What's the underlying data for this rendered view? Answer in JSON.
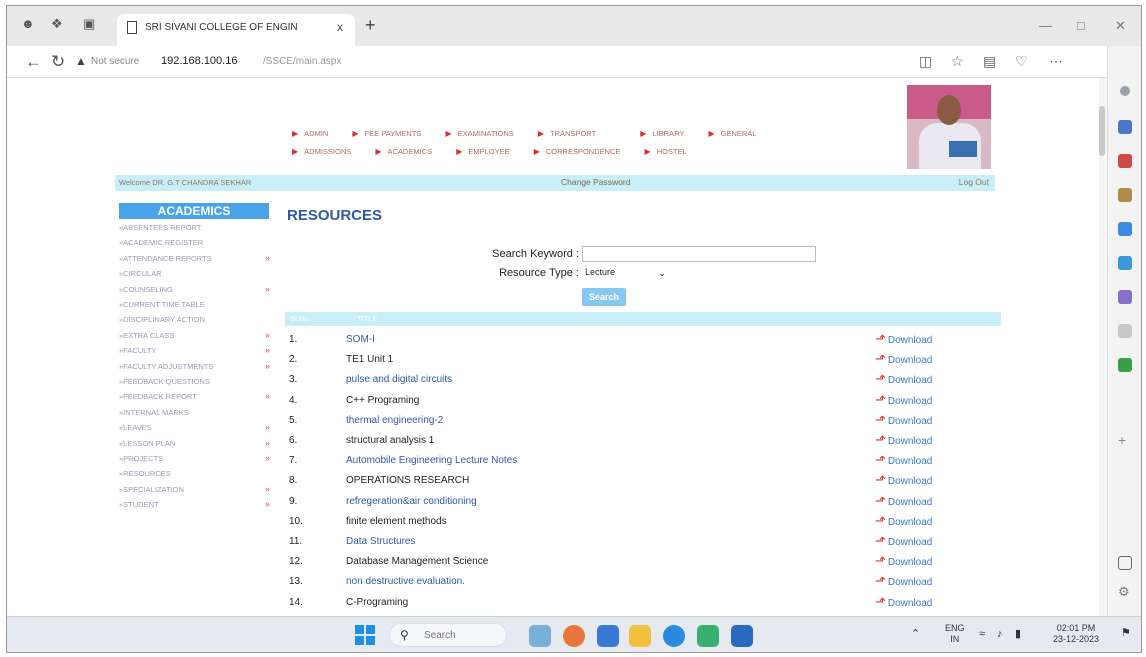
{
  "browser": {
    "tab_title": "SRI SIVANI COLLEGE OF ENGIN",
    "new_tab": "+",
    "close_tab": "x",
    "not_secure": "Not secure",
    "url_host": "192.168.100.16",
    "url_path": "/SSCE/main.aspx"
  },
  "top_nav": {
    "row1": [
      "ADMIN",
      "FEE PAYMENTS",
      "EXAMINATIONS",
      "TRANSPORT",
      "LIBRARY",
      "GENERAL"
    ],
    "row2": [
      "ADMISSIONS",
      "ACADEMICS",
      "EMPLOYEE",
      "CORRESPONDENCE",
      "HOSTEL"
    ]
  },
  "welcome": {
    "text": "Welcome DR. G.T CHANDRA SEKHAR",
    "change_password": "Change Password",
    "logout": "Log Out"
  },
  "sidebar": {
    "header": "ACADEMICS",
    "items": [
      {
        "label": "ABSENTEES REPORT",
        "arrow": false
      },
      {
        "label": "ACADEMIC REGISTER",
        "arrow": false
      },
      {
        "label": "ATTENDANCE REPORTS",
        "arrow": true
      },
      {
        "label": "CIRCULAR",
        "arrow": false
      },
      {
        "label": "COUNSELING",
        "arrow": true
      },
      {
        "label": "CURRENT TIME TABLE",
        "arrow": false
      },
      {
        "label": "DISCIPLINARY ACTION",
        "arrow": false
      },
      {
        "label": "EXTRA CLASS",
        "arrow": true
      },
      {
        "label": "FACULTY",
        "arrow": true
      },
      {
        "label": "FACULTY ADJUSTMENTS",
        "arrow": true
      },
      {
        "label": "FEEDBACK QUESTIONS",
        "arrow": false
      },
      {
        "label": "FEEDBACK REPORT",
        "arrow": true
      },
      {
        "label": "INTERNAL MARKS",
        "arrow": false
      },
      {
        "label": "LEAVES",
        "arrow": true
      },
      {
        "label": "LESSON PLAN",
        "arrow": true
      },
      {
        "label": "PROJECTS",
        "arrow": true
      },
      {
        "label": "RESOURCES",
        "arrow": false
      },
      {
        "label": "SPECIALIZATION",
        "arrow": true
      },
      {
        "label": "STUDENT",
        "arrow": true
      }
    ]
  },
  "main": {
    "title": "RESOURCES",
    "search_label": "Search Keyword :",
    "search_value": "",
    "type_label": "Resource Type :",
    "type_value": "Lecture",
    "search_button": "Search",
    "col_sno": "Sl.No.",
    "col_title": "TITLE",
    "download_label": "Download",
    "rows": [
      {
        "sno": "1.",
        "title": "SOM-I",
        "blue": true
      },
      {
        "sno": "2.",
        "title": "TE1 Unit 1",
        "blue": false
      },
      {
        "sno": "3.",
        "title": "pulse and digital circuits",
        "blue": true
      },
      {
        "sno": "4.",
        "title": "C++ Programing",
        "blue": false
      },
      {
        "sno": "5.",
        "title": "thermal engineering-2",
        "blue": true
      },
      {
        "sno": "6.",
        "title": "structural analysis 1",
        "blue": false
      },
      {
        "sno": "7.",
        "title": "Automobile Engineering Lecture Notes",
        "blue": true
      },
      {
        "sno": "8.",
        "title": "OPERATIONS RESEARCH",
        "blue": false
      },
      {
        "sno": "9.",
        "title": "refregeration&air conditioning",
        "blue": true
      },
      {
        "sno": "10.",
        "title": "finite element methods",
        "blue": false
      },
      {
        "sno": "11.",
        "title": "Data Structures",
        "blue": true
      },
      {
        "sno": "12.",
        "title": "Database Management Science",
        "blue": false
      },
      {
        "sno": "13.",
        "title": "non destructive evaluation.",
        "blue": true
      },
      {
        "sno": "14.",
        "title": "C-Programing",
        "blue": false
      }
    ]
  },
  "taskbar": {
    "search_placeholder": "Search",
    "lang": "ENG",
    "region": "IN",
    "time": "02:01 PM",
    "date": "23-12-2023"
  },
  "colors": {
    "accent_blue": "#2e5aa8",
    "header_bar": "#c8eef8",
    "sidebar_header": "#4aa3e8",
    "search_button": "#87c8f2",
    "pdf_icon": "#e03a2a"
  }
}
